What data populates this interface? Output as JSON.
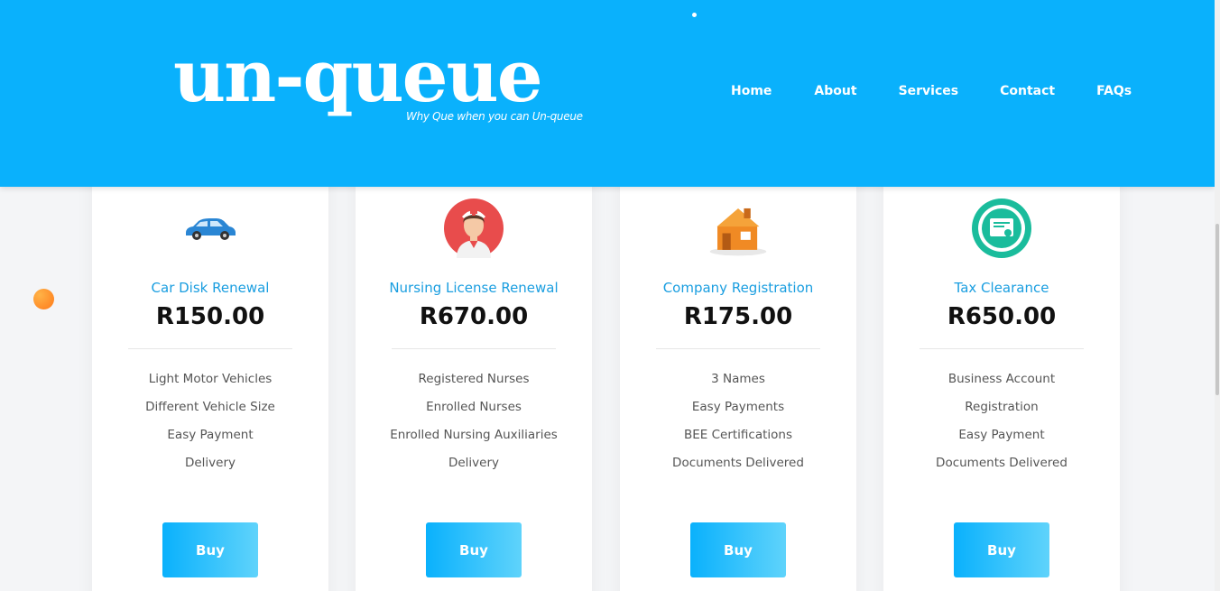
{
  "header": {
    "logo_text": "un-queue",
    "tagline": "Why Que when you can Un-queue",
    "nav": [
      "Home",
      "About",
      "Services",
      "Contact",
      "FAQs"
    ]
  },
  "colors": {
    "brand": "#0ab1fc",
    "title": "#1a9ee0",
    "orb": "#ff8c26"
  },
  "cards": [
    {
      "icon": "car-icon",
      "title": "Car Disk Renewal",
      "price": "R150.00",
      "features": [
        "Light Motor Vehicles",
        "Different Vehicle Size",
        "Easy Payment",
        "Delivery"
      ],
      "button": "Buy"
    },
    {
      "icon": "nurse-icon",
      "title": "Nursing License Renewal",
      "price": "R670.00",
      "features": [
        "Registered Nurses",
        "Enrolled Nurses",
        "Enrolled Nursing Auxiliaries",
        "Delivery"
      ],
      "button": "Buy"
    },
    {
      "icon": "house-icon",
      "title": "Company Registration",
      "price": "R175.00",
      "features": [
        "3 Names",
        "Easy Payments",
        "BEE Certifications",
        "Documents Delivered"
      ],
      "button": "Buy"
    },
    {
      "icon": "certificate-icon",
      "title": "Tax Clearance",
      "price": "R650.00",
      "features": [
        "Business Account",
        "Registration",
        "Easy Payment",
        "Documents Delivered"
      ],
      "button": "Buy"
    }
  ]
}
